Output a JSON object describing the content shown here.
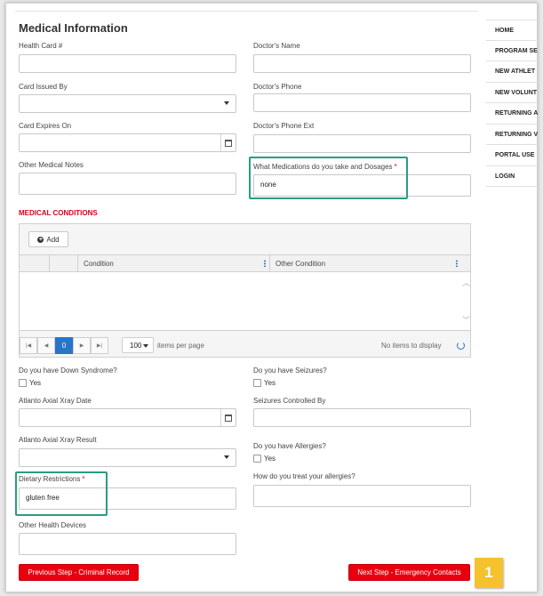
{
  "page_title": "Medical Information",
  "fields": {
    "health_card": {
      "label": "Health Card #",
      "value": ""
    },
    "doctor_name": {
      "label": "Doctor's Name",
      "value": ""
    },
    "card_issued_by": {
      "label": "Card Issued By",
      "value": ""
    },
    "doctor_phone": {
      "label": "Doctor's Phone",
      "value": ""
    },
    "card_expires": {
      "label": "Card Expires On",
      "value": ""
    },
    "doctor_phone_ext": {
      "label": "Doctor's Phone Ext",
      "value": ""
    },
    "other_medical_notes": {
      "label": "Other Medical Notes",
      "value": ""
    },
    "medications": {
      "label": "What Medications do you take and Dosages",
      "required_mark": "*",
      "value": "none"
    },
    "atlanto_date": {
      "label": "Atlanto Axial Xray Date",
      "value": ""
    },
    "seizures_controlled": {
      "label": "Seizures Controlled By",
      "value": ""
    },
    "atlanto_result": {
      "label": "Atlanto Axial Xray Result",
      "value": ""
    },
    "dietary": {
      "label": "Dietary Restrictions",
      "required_mark": "*",
      "value": "gluten free"
    },
    "treat_allergies": {
      "label": "How do you treat your allergies?",
      "value": ""
    },
    "other_devices": {
      "label": "Other Health Devices",
      "value": ""
    }
  },
  "questions": {
    "down_syndrome": {
      "label": "Do you have Down Syndrome?",
      "option": "Yes"
    },
    "seizures": {
      "label": "Do you have Seizures?",
      "option": "Yes"
    },
    "allergies": {
      "label": "Do you have Allergies?",
      "option": "Yes"
    }
  },
  "medical_conditions": {
    "title": "MEDICAL CONDITIONS",
    "add_label": "Add",
    "columns": [
      "Condition",
      "Other Condition"
    ],
    "pager": {
      "current_page": "0",
      "page_size": "100",
      "page_size_suffix": "items per page",
      "empty_text": "No items to display"
    }
  },
  "buttons": {
    "previous": "Previous Step - Criminal Record",
    "next": "Next Step - Emergency Contacts"
  },
  "step_badge": "1",
  "sidebar": {
    "items": [
      "HOME",
      "PROGRAM SE",
      "NEW ATHLET",
      "NEW VOLUNT",
      "RETURNING A",
      "RETURNING V",
      "PORTAL USE",
      "LOGIN"
    ]
  },
  "colors": {
    "accent_red": "#e8000f",
    "highlight_teal": "#2a9c84",
    "badge_yellow": "#f5c12c",
    "link_blue": "#2874c9"
  }
}
